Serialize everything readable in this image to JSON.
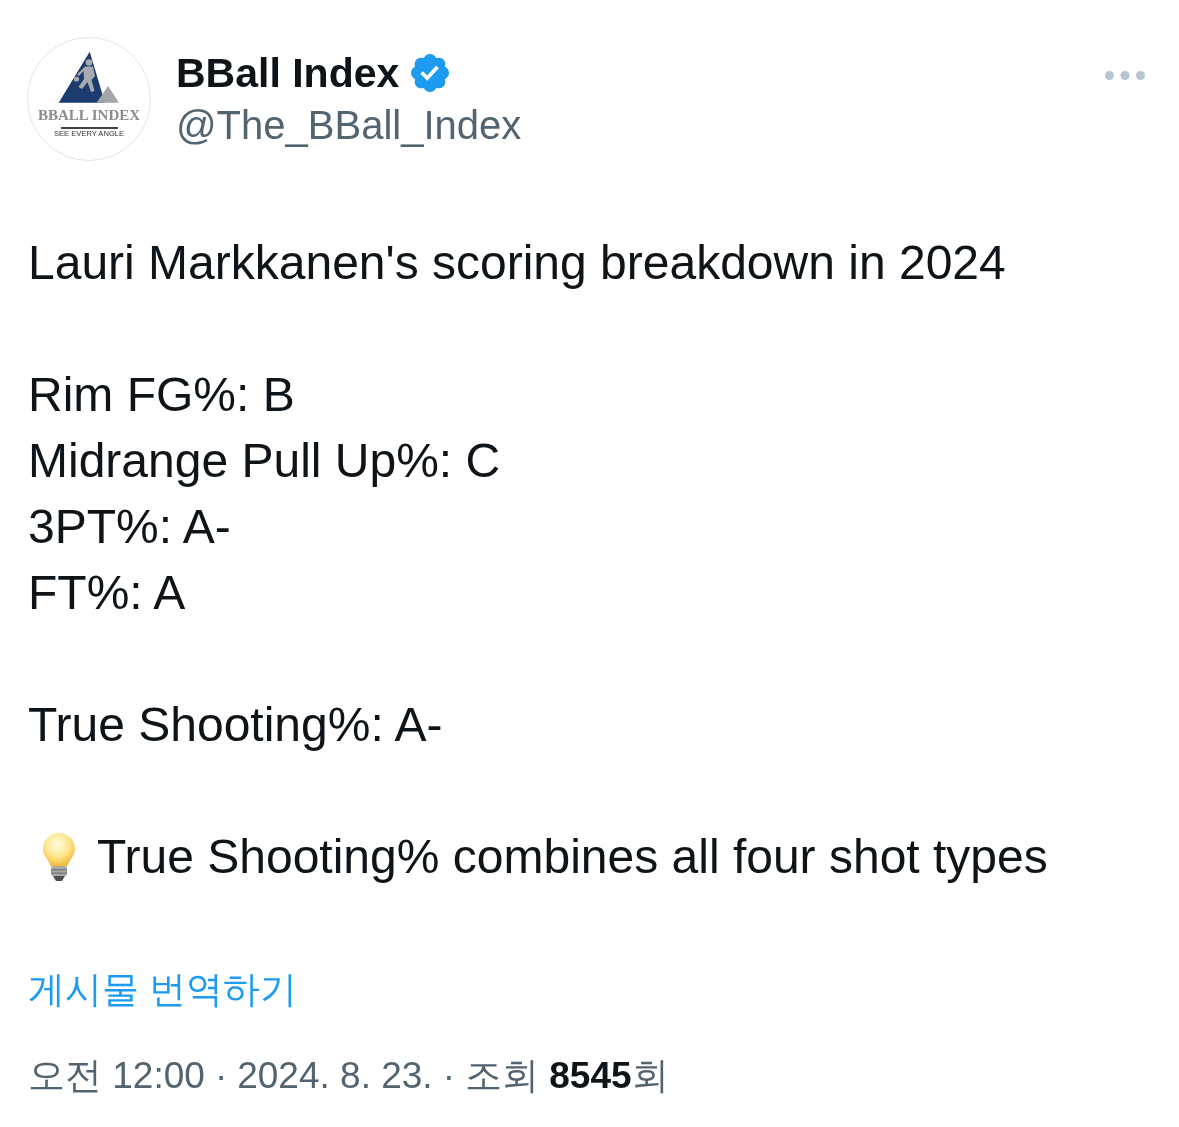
{
  "author": {
    "avatar": {
      "logo_text": "BBALL INDEX",
      "tagline": "SEE EVERY ANGLE"
    },
    "name": "BBall Index",
    "verified": true,
    "handle": "@The_BBall_Index"
  },
  "post": {
    "paragraphs": [
      {
        "kind": "plain",
        "lines": [
          "Lauri Markkanen's scoring breakdown in 2024"
        ]
      },
      {
        "kind": "plain",
        "lines": [
          "Rim FG%: B",
          "Midrange Pull Up%: C",
          "3PT%: A-",
          "FT%: A"
        ]
      },
      {
        "kind": "plain",
        "lines": [
          "True Shooting%: A-"
        ]
      },
      {
        "kind": "tip",
        "lines": [
          "True Shooting% combines all four shot types"
        ]
      }
    ]
  },
  "translate_link": "게시물 번역하기",
  "meta": [
    {
      "kind": "time",
      "text": "오전 12:00"
    },
    {
      "kind": "separator",
      "text": "·"
    },
    {
      "kind": "date",
      "text": "2024. 8. 23."
    },
    {
      "kind": "separator",
      "text": "·"
    },
    {
      "kind": "views",
      "text": "조회 **8545**회"
    }
  ]
}
